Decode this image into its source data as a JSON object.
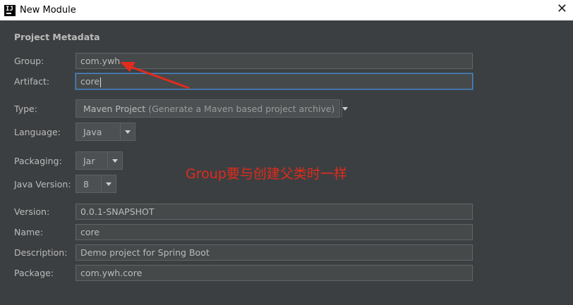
{
  "window": {
    "title": "New Module",
    "icon": "intellij-icon",
    "close_icon": "close-icon"
  },
  "section": {
    "title": "Project Metadata"
  },
  "fields": {
    "group": {
      "label": "Group:",
      "value": "com.ywh"
    },
    "artifact": {
      "label": "Artifact:",
      "value": "core"
    },
    "type": {
      "label": "Type:",
      "value": "Maven Project",
      "hint": "(Generate a Maven based project archive)"
    },
    "language": {
      "label": "Language:",
      "value": "Java"
    },
    "packaging": {
      "label": "Packaging:",
      "value": "Jar"
    },
    "java_version": {
      "label": "Java Version:",
      "value": "8"
    },
    "version": {
      "label": "Version:",
      "value": "0.0.1-SNAPSHOT"
    },
    "name": {
      "label": "Name:",
      "value": "core"
    },
    "description": {
      "label": "Description:",
      "value": "Demo project for Spring Boot"
    },
    "package": {
      "label": "Package:",
      "value": "com.ywh.core"
    }
  },
  "annotation": {
    "text": "Group要与创建父类时一样",
    "color": "#e12b1c"
  },
  "colors": {
    "background": "#3c3f41",
    "field_bg": "#45494a",
    "focus_border": "#4a88c7"
  }
}
